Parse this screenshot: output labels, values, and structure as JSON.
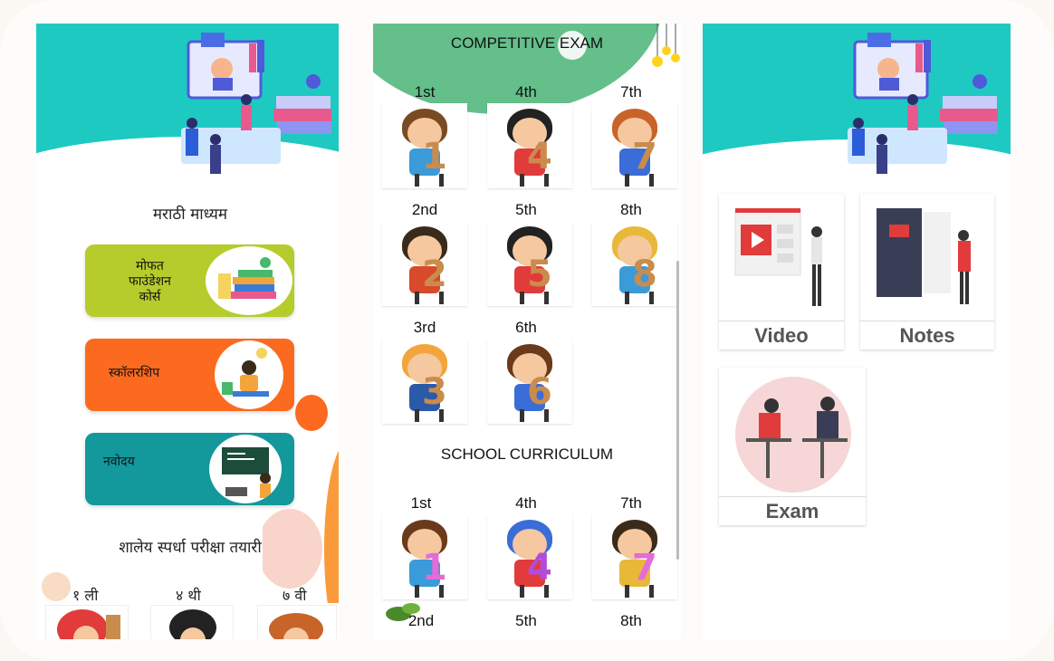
{
  "screen1": {
    "medium_title": "मराठी माध्यम",
    "cards": [
      {
        "label": "मोफत\nफाउंडेशन\nकोर्स",
        "color": "#b6cc2c"
      },
      {
        "label": "स्कॉलरशिप",
        "color": "#fb6a1f"
      },
      {
        "label": "नवोदय",
        "color": "#13989c"
      }
    ],
    "school_title": "शालेय स्पर्धा परीक्षा तयारी",
    "standards": [
      "१ ली",
      "४ थी",
      "७ वी"
    ]
  },
  "screen2": {
    "competitive_title": "COMPETITIVE EXAM",
    "competitive_grades": [
      "1st",
      "4th",
      "7th",
      "2nd",
      "5th",
      "8th",
      "3rd",
      "6th"
    ],
    "school_title": "SCHOOL CURRICULUM",
    "school_grades": [
      "1st",
      "4th",
      "7th",
      "2nd",
      "5th",
      "8th"
    ]
  },
  "screen3": {
    "tiles": [
      "Video",
      "Notes",
      "Exam"
    ]
  },
  "colors": {
    "teal": "#1ec9c2",
    "green": "#64bf8a",
    "lime": "#b6cc2c",
    "orange": "#fb6a1f",
    "darkteal": "#13989c"
  }
}
